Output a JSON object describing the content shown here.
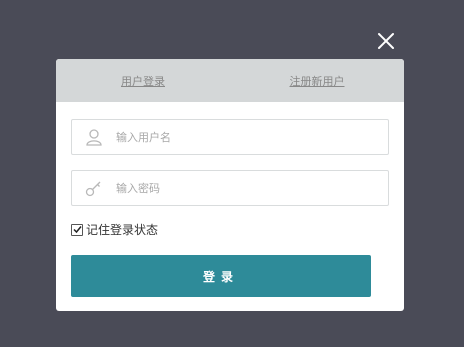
{
  "tabs": {
    "login_label": "用户登录",
    "register_label": "注册新用户"
  },
  "form": {
    "username_placeholder": "输入用户名",
    "username_value": "",
    "password_placeholder": "输入密码",
    "password_value": "",
    "remember_label": "记住登录状态",
    "remember_checked": true,
    "submit_label": "登录"
  },
  "icons": {
    "close": "close-icon",
    "user": "user-icon",
    "key": "key-icon",
    "check": "check-icon"
  },
  "colors": {
    "backdrop": "#4a4b57",
    "tab_bar": "#d4d7d8",
    "primary_button": "#2e8b99"
  }
}
